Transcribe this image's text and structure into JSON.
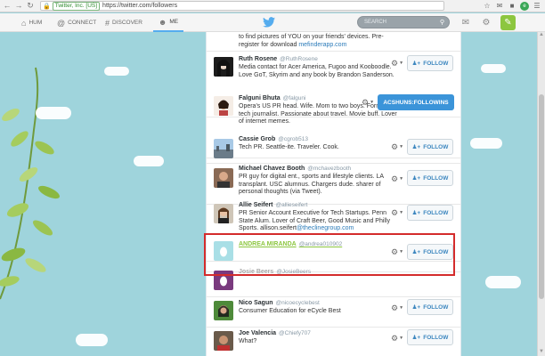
{
  "browser": {
    "cert_label": "Twitter, Inc. [US]",
    "url": "https://twitter.com/followers"
  },
  "topnav": {
    "home": "Hum",
    "connect": "Connect",
    "discover": "Discover",
    "me": "Me",
    "search_placeholder": "Search"
  },
  "followers": [
    {
      "name": "",
      "handle": "",
      "bio": "to find pictures of YOU on your friends' devices. Pre-register for download ",
      "bio_link": "mefinderapp.com",
      "button": "Follow"
    },
    {
      "name": "Ruth Rosene",
      "handle": "@RuthRosene",
      "bio": "Media contact for Acer America, Fugoo and Kooboodle. Love GoT, Skyrim and any book by Brandon Sanderson.",
      "button": "Follow"
    },
    {
      "name": "Falguni Bhuta",
      "handle": "@falguni",
      "bio": "Opera's US PR head. Wife. Mom to two boys. Former tech journalist. Passionate about travel. Movie buff. Lover of internet memes.",
      "button": "ACSHUNS:FOLLOWINS"
    },
    {
      "name": "Cassie Grob",
      "handle": "@cgrob513",
      "bio": "Tech PR. Seattle-ite. Traveler. Cook.",
      "button": "Follow"
    },
    {
      "name": "Michael Chavez Booth",
      "handle": "@mchavezbooth",
      "bio": "PR guy for digital ent., sports and lifestyle clients. LA transplant. USC alumnus. Chargers dude. sharer of personal thoughts (via Tweet).",
      "button": "Follow"
    },
    {
      "name": "Allie Seifert",
      "handle": "@allieseifert",
      "bio": "PR Senior Account Executive for Tech Startups. Penn State Alum. Lover of Craft Beer, Good Music and Philly Sports. allison.seifert",
      "bio_link": "@theclinegroup.com",
      "button": "Follow"
    },
    {
      "name": "ANDREA MIRANDA",
      "handle": "@andrea010902",
      "bio": "",
      "button": "Follow"
    },
    {
      "name": "Josie Beers",
      "handle": "@JosieBeers",
      "bio": "",
      "button": ""
    },
    {
      "name": "Nico Sagun",
      "handle": "@nicoecyclebest",
      "bio": "Consumer Education for eCycle Best",
      "button": "Follow"
    },
    {
      "name": "Joe Valencia",
      "handle": "@Chiefy707",
      "bio": "What?",
      "button": "Follow"
    }
  ],
  "colors": {
    "background": "#9fd4dc",
    "accent": "#55acee",
    "highlight": "#d42c2c",
    "compose": "#8cc63f"
  }
}
